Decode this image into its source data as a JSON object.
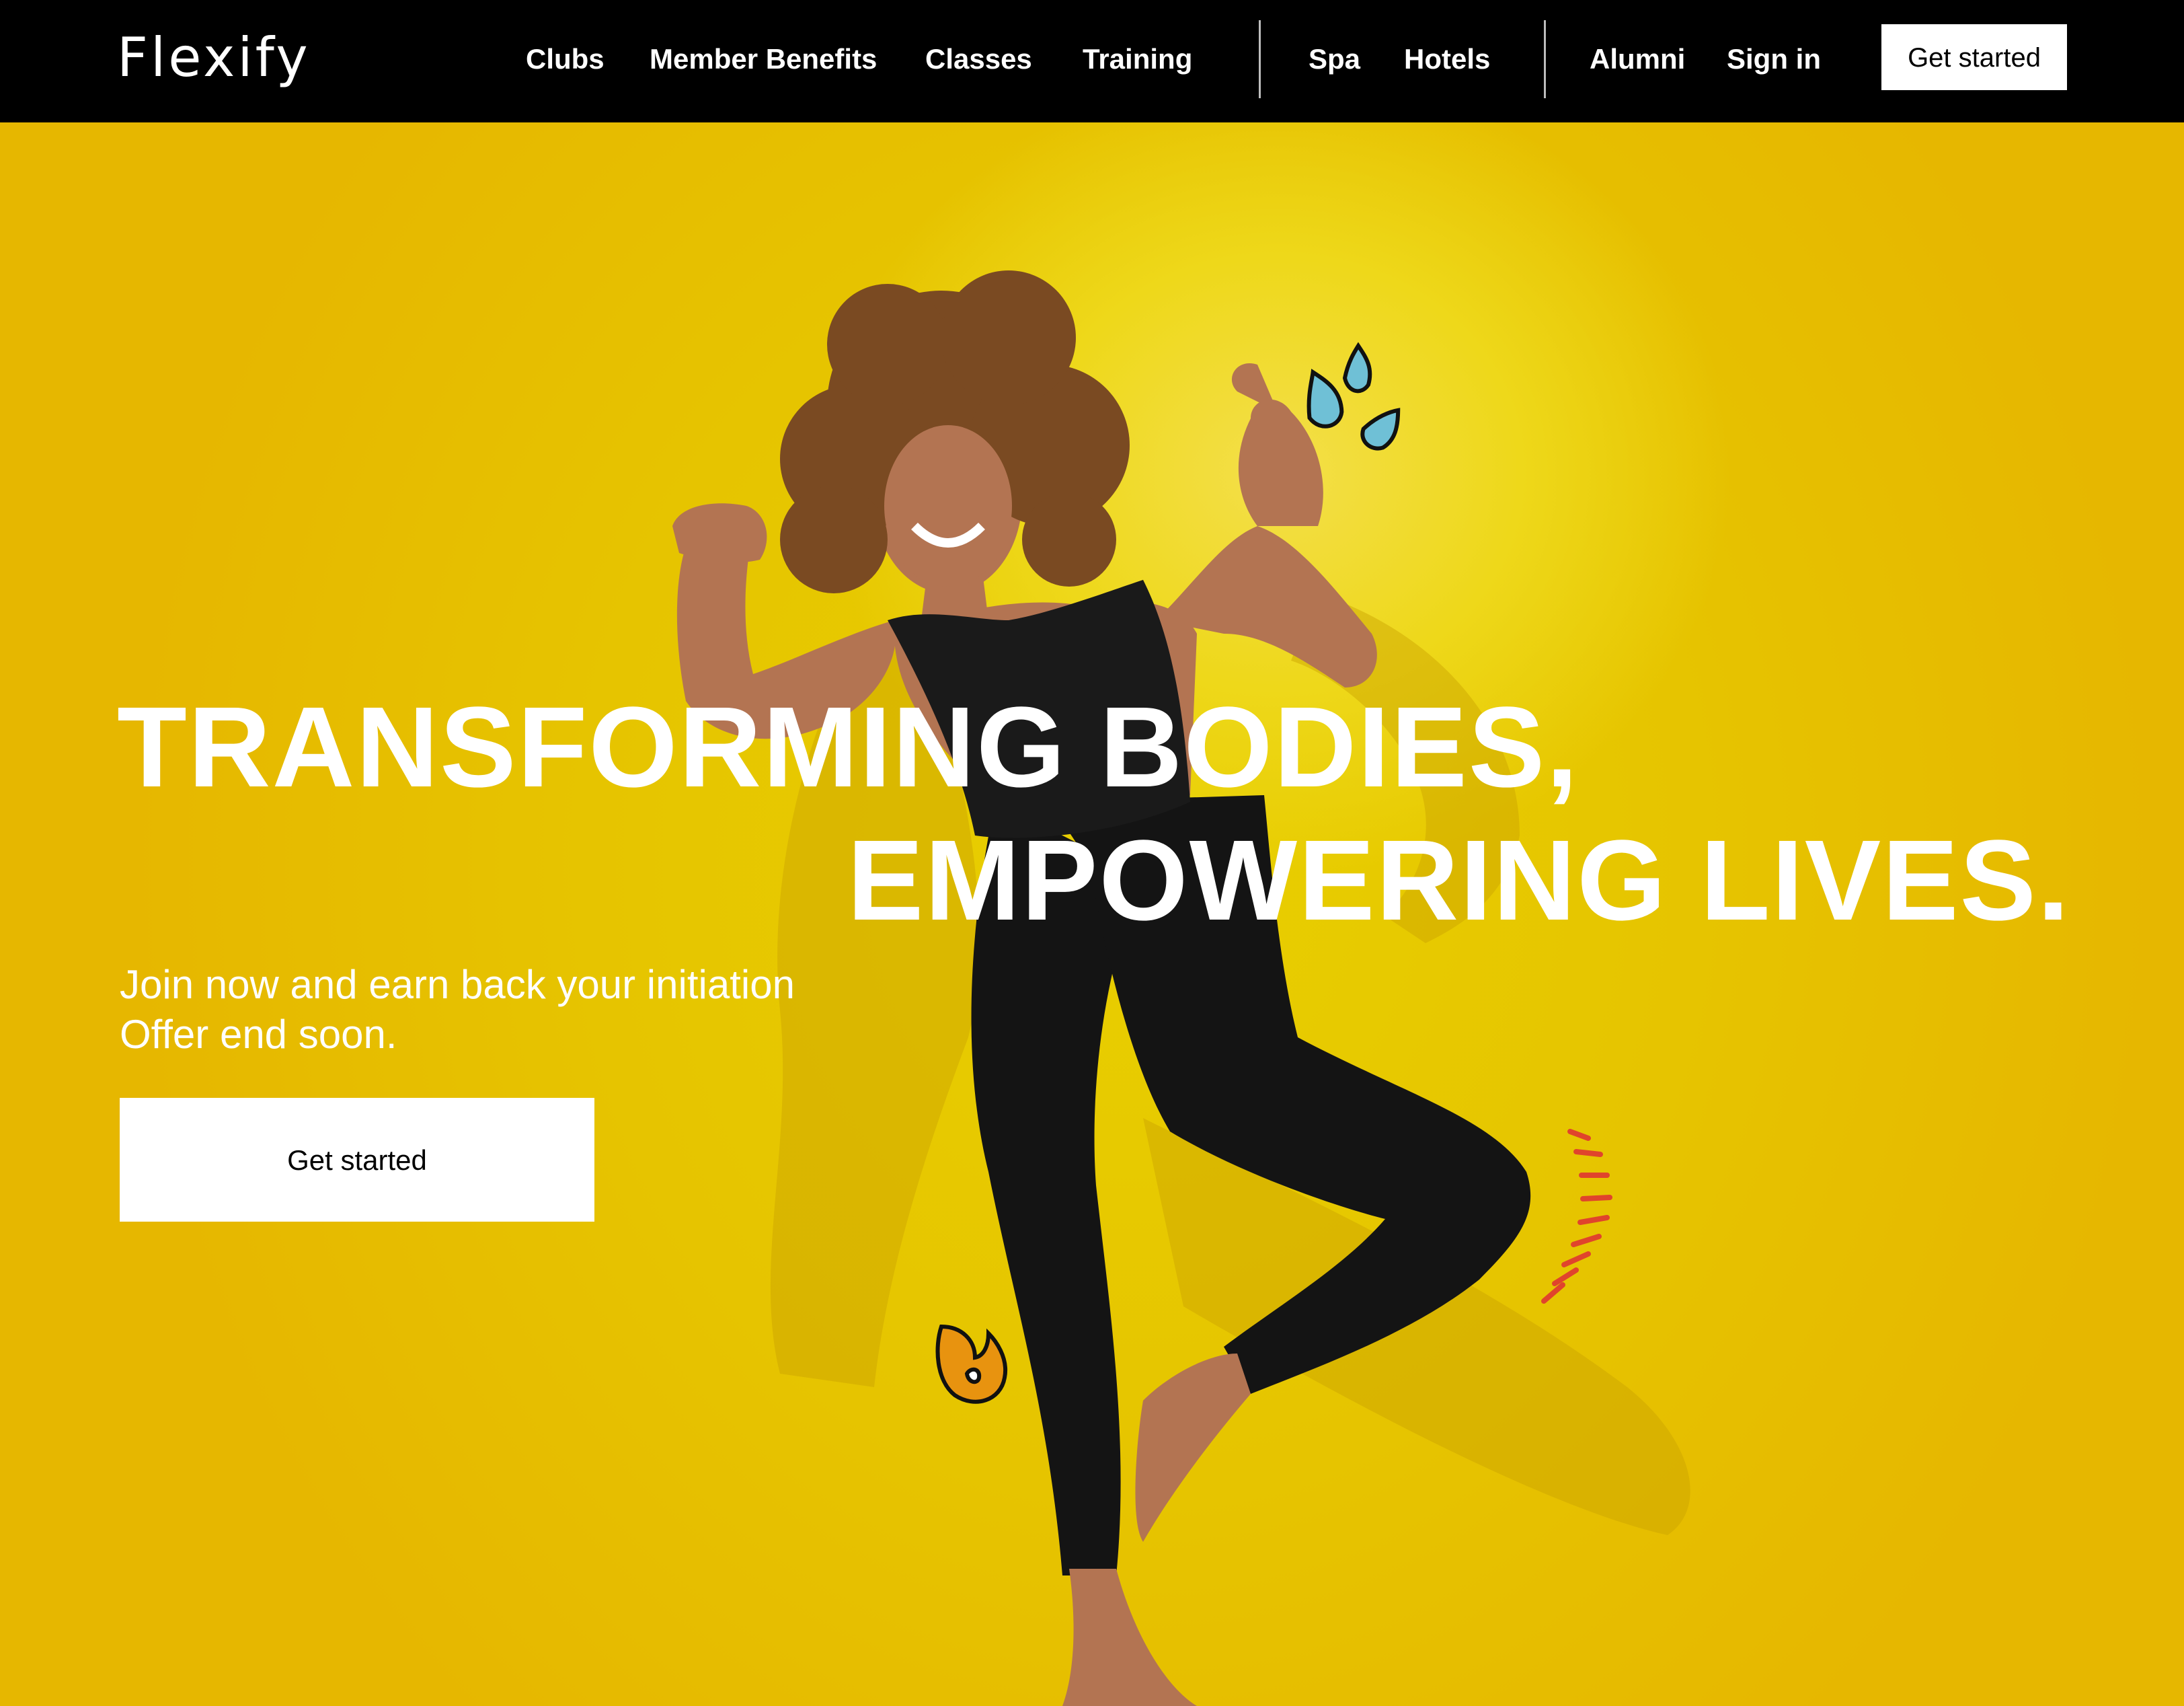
{
  "header": {
    "logo_text": "Flexify",
    "nav": [
      {
        "label": "Clubs"
      },
      {
        "label": "Member Benefits"
      },
      {
        "label": "Classes"
      },
      {
        "label": "Training"
      },
      {
        "label": "Spa"
      },
      {
        "label": "Hotels"
      },
      {
        "label": "Alumni"
      },
      {
        "label": "Sign in"
      }
    ],
    "cta_label": "Get started"
  },
  "hero": {
    "headline_line1": "TRANSFORMING BODIES,",
    "headline_line2": "EMPOWERING LIVES.",
    "subtext_line1": "Join now and earn back your initiation",
    "subtext_line2": "Offer end soon.",
    "cta_label": "Get started",
    "background_color": "#e9c800",
    "decorations": [
      "sweat-drops-icon",
      "motion-lines-icon",
      "flame-icon"
    ]
  }
}
